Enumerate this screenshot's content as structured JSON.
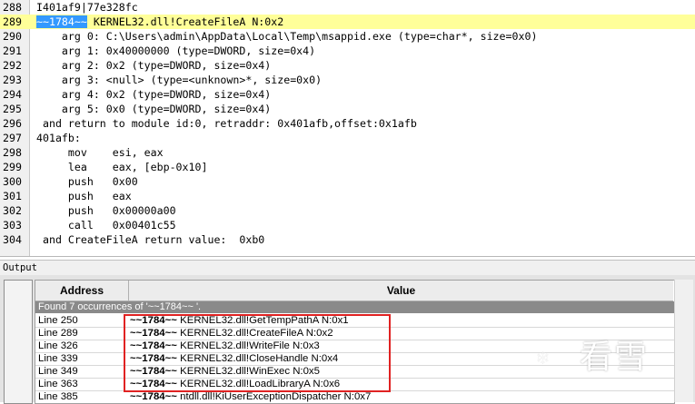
{
  "editor": {
    "lines": [
      {
        "num": "288",
        "text": "I401af9|77e328fc"
      },
      {
        "num": "289",
        "marker": "~~1784~~",
        "text": " KERNEL32.dll!CreateFileA N:0x2"
      },
      {
        "num": "290",
        "text": "    arg 0: C:\\Users\\admin\\AppData\\Local\\Temp\\msappid.exe (type=char*, size=0x0)"
      },
      {
        "num": "291",
        "text": "    arg 1: 0x40000000 (type=DWORD, size=0x4)"
      },
      {
        "num": "292",
        "text": "    arg 2: 0x2 (type=DWORD, size=0x4)"
      },
      {
        "num": "293",
        "text": "    arg 3: <null> (type=<unknown>*, size=0x0)"
      },
      {
        "num": "294",
        "text": "    arg 4: 0x2 (type=DWORD, size=0x4)"
      },
      {
        "num": "295",
        "text": "    arg 5: 0x0 (type=DWORD, size=0x4)"
      },
      {
        "num": "296",
        "text": " and return to module id:0, retraddr: 0x401afb,offset:0x1afb"
      },
      {
        "num": "297",
        "text": "401afb:"
      },
      {
        "num": "298",
        "text": "     mov    esi, eax"
      },
      {
        "num": "299",
        "text": "     lea    eax, [ebp-0x10]"
      },
      {
        "num": "300",
        "text": "     push   0x00"
      },
      {
        "num": "301",
        "text": "     push   eax"
      },
      {
        "num": "302",
        "text": "     push   0x00000a00"
      },
      {
        "num": "303",
        "text": "     call   0x00401c55"
      },
      {
        "num": "304",
        "text": " and CreateFileA return value:  0xb0"
      }
    ]
  },
  "output": {
    "title": "Output",
    "headers": {
      "address": "Address",
      "value": "Value"
    },
    "found": "Found 7 occurrences of '~~1784~~ '.",
    "rows": [
      {
        "address": "Line 250",
        "id": "~~1784~~",
        "rest": " KERNEL32.dll!GetTempPathA N:0x1"
      },
      {
        "address": "Line 289",
        "id": "~~1784~~",
        "rest": " KERNEL32.dll!CreateFileA N:0x2"
      },
      {
        "address": "Line 326",
        "id": "~~1784~~",
        "rest": " KERNEL32.dll!WriteFile N:0x3"
      },
      {
        "address": "Line 339",
        "id": "~~1784~~",
        "rest": " KERNEL32.dll!CloseHandle N:0x4"
      },
      {
        "address": "Line 349",
        "id": "~~1784~~",
        "rest": " KERNEL32.dll!WinExec N:0x5"
      },
      {
        "address": "Line 363",
        "id": "~~1784~~",
        "rest": " KERNEL32.dll!LoadLibraryA N:0x6"
      },
      {
        "address": "Line 385",
        "id": "~~1784~~",
        "rest": " ntdll.dll!KiUserExceptionDispatcher N:0x7"
      }
    ]
  },
  "watermark": {
    "text": "看雪",
    "icon": "snowflake-icon"
  },
  "colors": {
    "highlight_line": "#ffff99",
    "marker_bg": "#3399ff",
    "selection_box": "#e02222"
  }
}
